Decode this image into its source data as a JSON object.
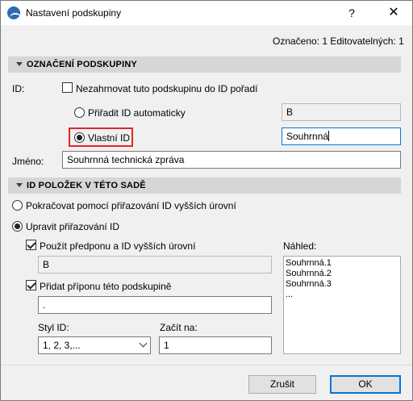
{
  "window": {
    "title": "Nastavení podskupiny",
    "help": "?",
    "close": "✕"
  },
  "status": {
    "marked": "Označeno: 1 Editovatelných: 1"
  },
  "section1": {
    "title": "OZNAČENÍ PODSKUPINY"
  },
  "id_row": {
    "label": "ID:",
    "exclude_label": "Nezahrnovat tuto podskupinu do ID pořadí",
    "auto_label": "Přiřadit ID automaticky",
    "auto_value": "B",
    "custom_label": "Vlastní ID",
    "custom_value": "Souhrnná"
  },
  "name_row": {
    "label": "Jméno:",
    "value": "Souhrnná technická zpráva"
  },
  "section2": {
    "title": "ID POLOŽEK V TÉTO SADĚ"
  },
  "items": {
    "continue_label": "Pokračovat pomocí přiřazování ID vyšších úrovní",
    "modify_label": "Upravit přiřazování ID",
    "prefix_label": "Použít předponu a ID vyšších úrovní",
    "prefix_value": "B",
    "suffix_label": "Přidat příponu této podskupině",
    "suffix_value": ".",
    "style_label": "Styl ID:",
    "style_value": "1, 2, 3,...",
    "start_label": "Začít na:",
    "start_value": "1",
    "preview_label": "Náhled:",
    "preview_lines": [
      "Souhrnná.1",
      "Souhrnná.2",
      "Souhrnná.3",
      "..."
    ]
  },
  "buttons": {
    "cancel": "Zrušit",
    "ok": "OK"
  },
  "colors": {
    "highlight": "#e0242b",
    "accent": "#0078d7"
  }
}
